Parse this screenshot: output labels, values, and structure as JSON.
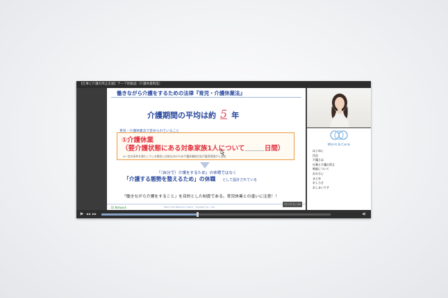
{
  "player": {
    "title": "【仕事と介護の両立支援】テーマ別動画（介護休業制度）",
    "progress_fraction": 0.42
  },
  "slide": {
    "heading": "働きながら介護をするための法律『育児・介護休業法』",
    "period_prefix": "介護期間の平均は約",
    "period_value": "5",
    "period_suffix": "年",
    "law_note": "育児・介護休業法で定められていること",
    "leave_title": "①介護休業",
    "leave_sub": "（要介護状態にある対象家族1人について",
    "leave_blank": "＿＿＿",
    "leave_days": "日間）",
    "leave_small": "※一定の条件を満たしている場合には給与の67%の介護休業給付金が雇用保険から支給",
    "design_line1": "「（自分で）介護をするため」の休暇ではなく",
    "design_line2": "「介護する態勢を整えるため」の休職",
    "design_line2_suffix": "として設計されている",
    "caution": "「働きながら介護をすること」を目的とした制度である。育児休業との違いに注意！！",
    "footer_logo": "Di Network",
    "footer_copy": "Work Life Balance Coach · Support Co., Ltd."
  },
  "page_indicator": "ページ 2 / 10",
  "panel": {
    "logo_text": "Work＆Care",
    "toc": [
      "はじめに",
      "目次",
      "介護とは",
      "仕事と介護の両立",
      "制度について",
      "おわりに",
      "まとめ",
      "おしらせ",
      "おしまいです"
    ]
  },
  "controls": {
    "play": "▶",
    "prev": "◀◀",
    "next": "▶▶",
    "volume": "◀)"
  },
  "colors": {
    "accent_blue": "#27479c",
    "accent_red": "#e23340",
    "box_border": "#e99a42"
  }
}
